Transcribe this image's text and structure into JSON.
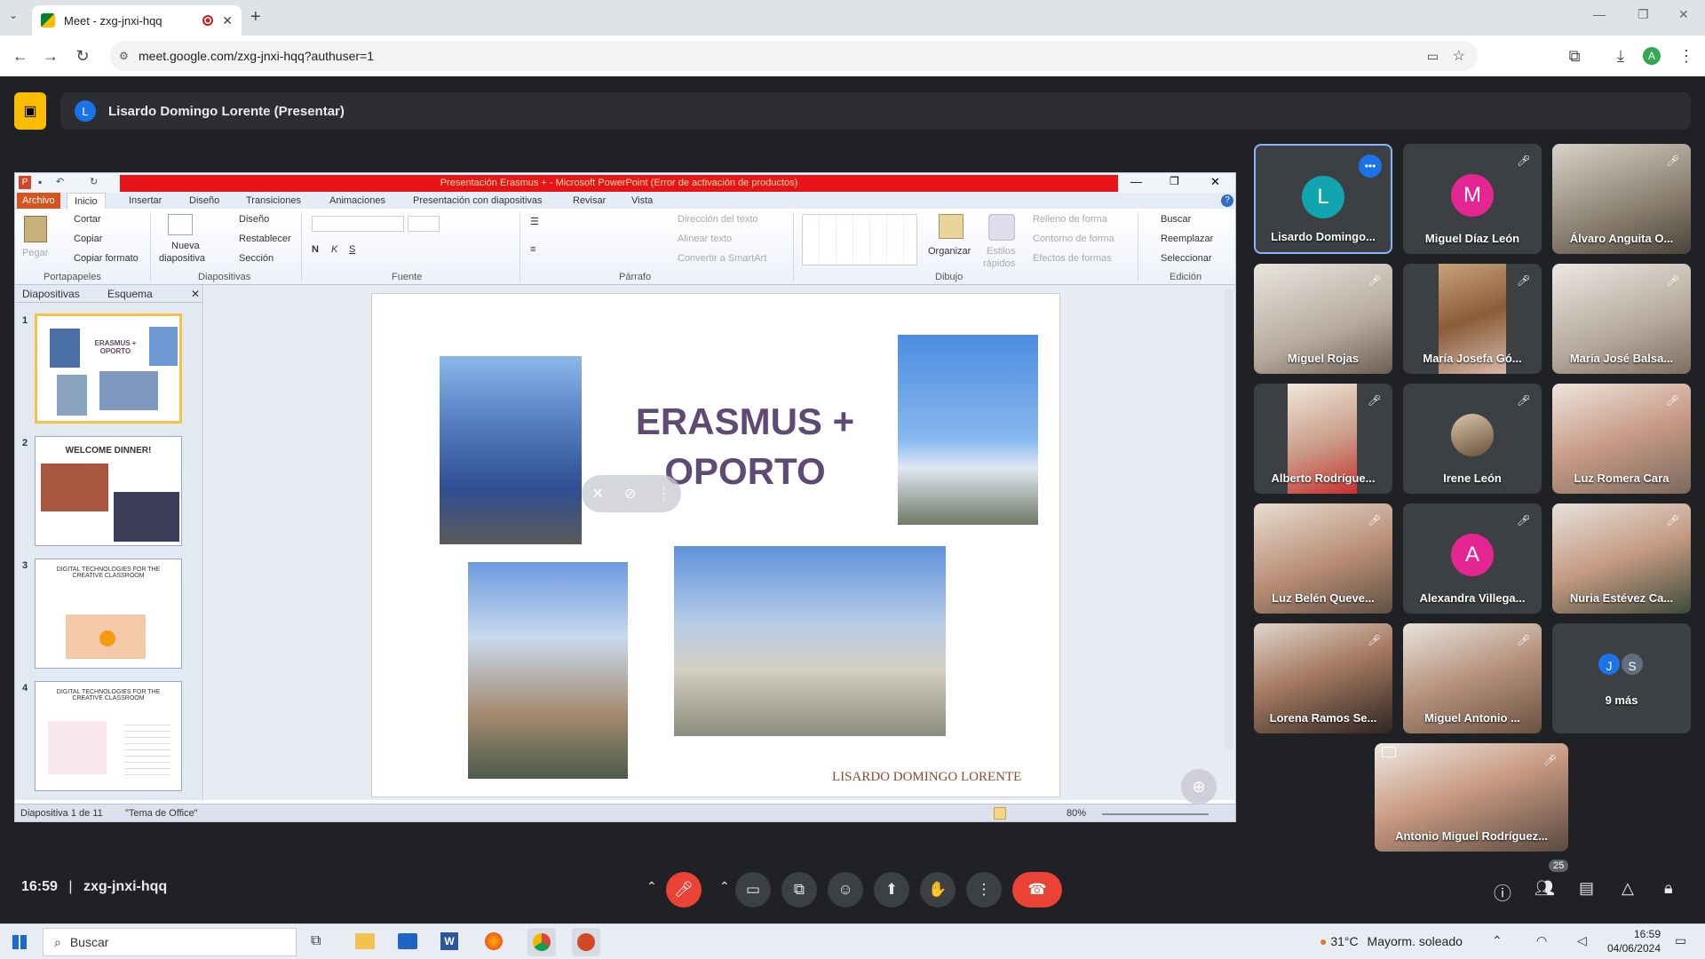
{
  "browser": {
    "tab_title": "Meet - zxg-jnxi-hqq",
    "url": "meet.google.com/zxg-jnxi-hqq?authuser=1",
    "profile_initial": "A"
  },
  "presenter_bar": {
    "initial": "L",
    "text": "Lisardo Domingo Lorente (Presentar)"
  },
  "powerpoint": {
    "title": "Presentación Erasmus + - Microsoft PowerPoint (Error de activación de productos)",
    "tabs": [
      "Archivo",
      "Inicio",
      "Insertar",
      "Diseño",
      "Transiciones",
      "Animaciones",
      "Presentación con diapositivas",
      "Revisar",
      "Vista"
    ],
    "ribbon": {
      "portapapeles": {
        "label": "Portapapeles",
        "pegar": "Pegar",
        "cortar": "Cortar",
        "copiar": "Copiar",
        "copiar_formato": "Copiar formato"
      },
      "diapositivas": {
        "label": "Diapositivas",
        "nueva": "Nueva",
        "diapositiva": "diapositiva",
        "diseno": "Diseño",
        "restablecer": "Restablecer",
        "seccion": "Sección"
      },
      "fuente": {
        "label": "Fuente"
      },
      "parrafo": {
        "label": "Párrafo",
        "direccion": "Dirección del texto",
        "alinear": "Alinear texto",
        "convertir": "Convertir a SmartArt"
      },
      "dibujo": {
        "label": "Dibujo",
        "organizar": "Organizar",
        "estilos": "Estilos",
        "rapidos": "rápidos",
        "relleno": "Relleno de forma",
        "contorno": "Contorno de forma",
        "efectos": "Efectos de formas"
      },
      "edicion": {
        "label": "Edición",
        "buscar": "Buscar",
        "reemplazar": "Reemplazar",
        "seleccionar": "Seleccionar"
      }
    },
    "pane_tabs": [
      "Diapositivas",
      "Esquema"
    ],
    "thumbnails": [
      {
        "num": "1",
        "title": "ERASMUS + OPORTO"
      },
      {
        "num": "2",
        "title": "WELCOME DINNER!"
      },
      {
        "num": "3",
        "title": "DIGITAL TECHNOLOGIES FOR THE CREATIVE CLASSROOM"
      },
      {
        "num": "4",
        "title": "DIGITAL TECHNOLOGIES FOR THE CREATIVE CLASSROOM"
      }
    ],
    "slide": {
      "title_line1": "ERASMUS +",
      "title_line2": "OPORTO",
      "author": "LISARDO DOMINGO LORENTE"
    },
    "status": {
      "slide_of": "Diapositiva 1 de 11",
      "theme": "\"Tema de Office\"",
      "zoom": "80%"
    }
  },
  "participants": [
    {
      "name": "Lisardo Domingo...",
      "initial": "L",
      "color": "#12a4af",
      "active": true
    },
    {
      "name": "Miguel Díaz León",
      "initial": "M",
      "color": "#e52592"
    },
    {
      "name": "Álvaro Anguita O..."
    },
    {
      "name": "Miguel Rojas"
    },
    {
      "name": "María Josefa Gó..."
    },
    {
      "name": "María José Balsa..."
    },
    {
      "name": "Alberto Rodrígue..."
    },
    {
      "name": "Irene León"
    },
    {
      "name": "Luz Romera Cara"
    },
    {
      "name": "Luz Belén Queve..."
    },
    {
      "name": "Alexandra Villega...",
      "initial": "A",
      "color": "#e52592"
    },
    {
      "name": "Nuria Estévez Ca..."
    },
    {
      "name": "Lorena Ramos Se..."
    },
    {
      "name": "Miguel Antonio ..."
    },
    {
      "name": "9 más",
      "chips": [
        "J",
        "S"
      ]
    },
    {
      "name": "Antonio Miguel Rodríguez..."
    }
  ],
  "bottom_bar": {
    "time": "16:59",
    "meeting_code": "zxg-jnxi-hqq",
    "people_count": "25"
  },
  "taskbar": {
    "search_placeholder": "Buscar",
    "weather_temp": "31°C",
    "weather_desc": "Mayorm. soleado",
    "clock_time": "16:59",
    "clock_date": "04/06/2024"
  }
}
